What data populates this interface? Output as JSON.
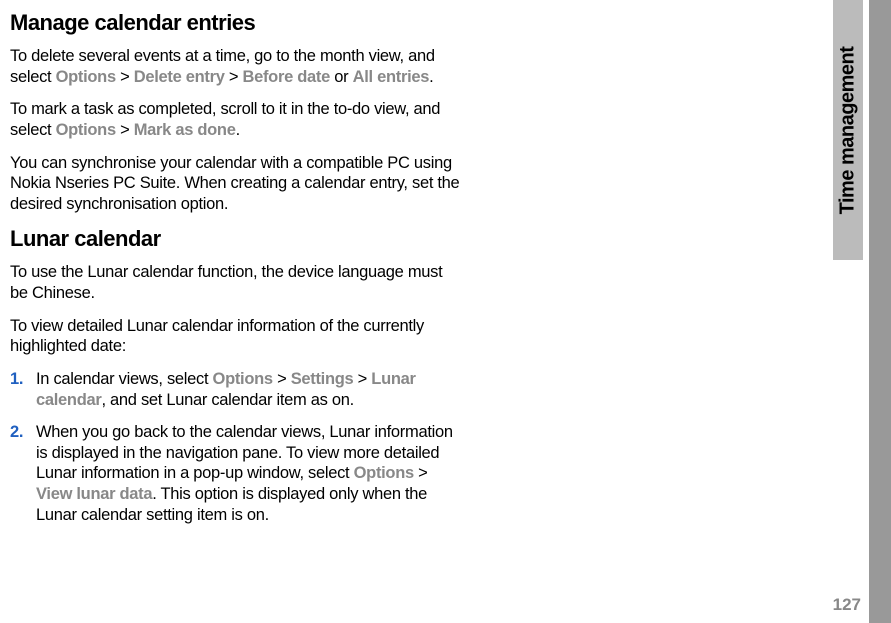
{
  "sideTab": "Time management",
  "pageNumber": "127",
  "h1": "Manage calendar entries",
  "p1_a": "To delete several events at a time, go to the month view, and select ",
  "p1_opt": "Options",
  "p1_gt1": " > ",
  "p1_del": "Delete entry",
  "p1_gt2": " > ",
  "p1_before": "Before date",
  "p1_or": " or ",
  "p1_all": "All entries",
  "p1_dot": ".",
  "p2_a": "To mark a task as completed, scroll to it in the to-do view, and select ",
  "p2_opt": "Options",
  "p2_gt": " > ",
  "p2_mark": "Mark as done",
  "p2_dot": ".",
  "p3": "You can synchronise your calendar with a compatible PC using Nokia Nseries PC Suite. When creating a calendar entry, set the desired synchronisation option.",
  "h2": "Lunar calendar",
  "p4": "To use the Lunar calendar function, the device language must be Chinese.",
  "p5": "To view detailed Lunar calendar information of the currently highlighted date:",
  "li1_num": "1.",
  "li1_a": "In calendar views, select ",
  "li1_opt": "Options",
  "li1_gt1": " > ",
  "li1_set": "Settings",
  "li1_gt2": " > ",
  "li1_lunar": "Lunar calendar",
  "li1_b": ", and set Lunar calendar item as on.",
  "li2_num": "2.",
  "li2_a": "When you go back to the calendar views, Lunar information is displayed in the navigation pane. To view more detailed Lunar information in a pop-up window, select ",
  "li2_opt": "Options",
  "li2_gt": " > ",
  "li2_view": "View lunar data",
  "li2_b": ". This option is displayed only when the Lunar calendar setting item is on."
}
